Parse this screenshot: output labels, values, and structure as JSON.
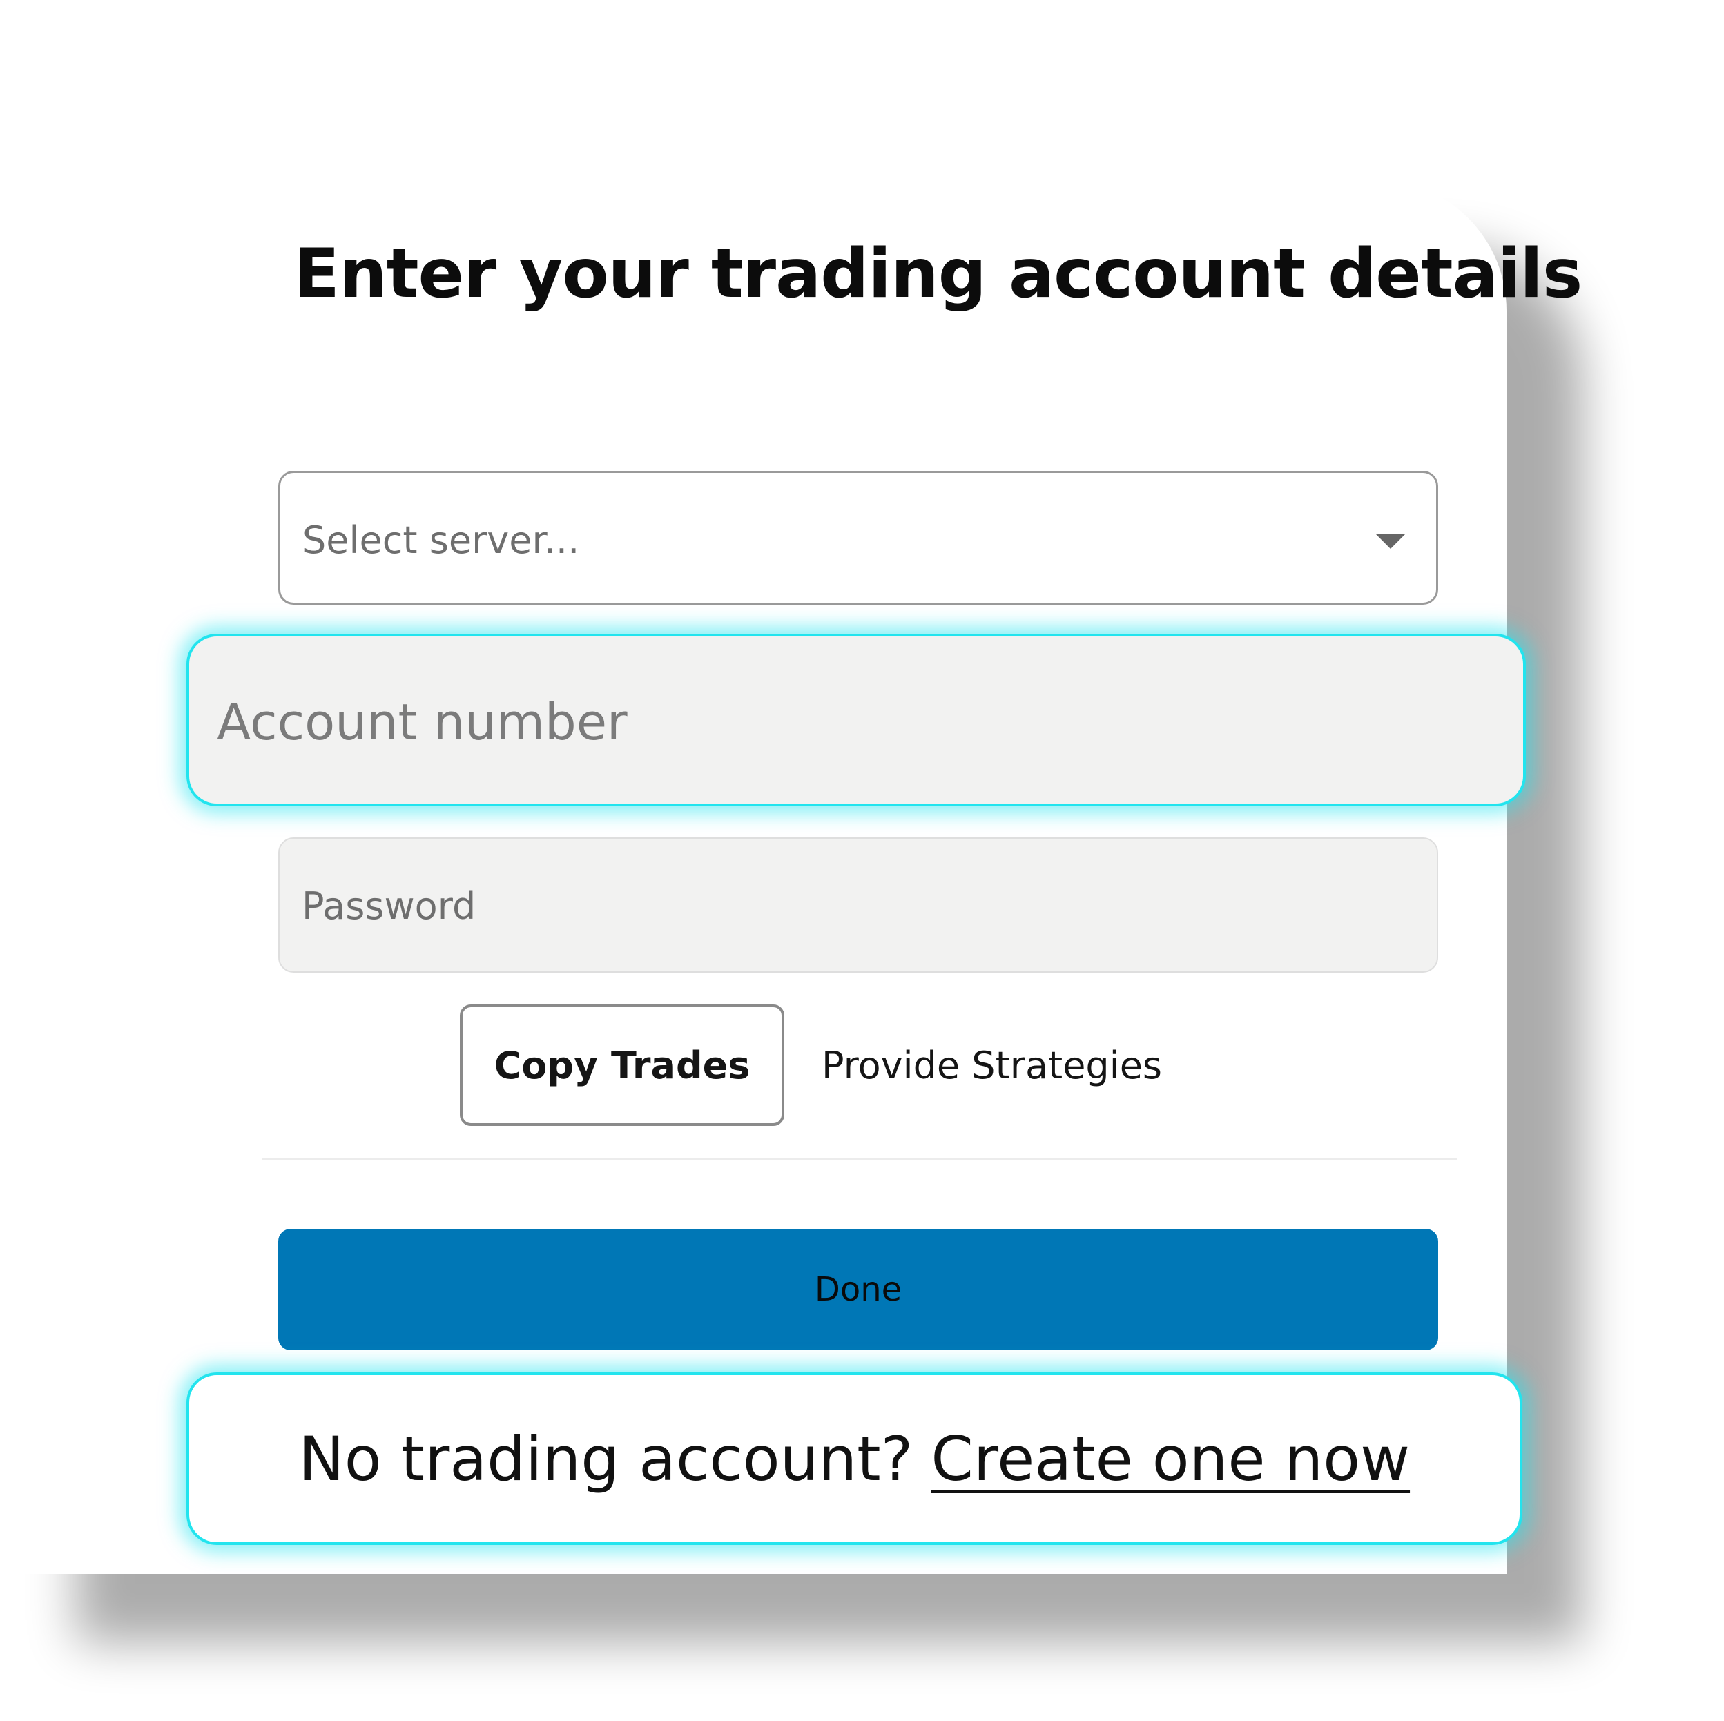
{
  "dialog": {
    "title": "Enter your trading account details"
  },
  "form": {
    "server_select": {
      "placeholder": "Select server...",
      "icon": "chevron-down-icon"
    },
    "account_number": {
      "placeholder": "Account number",
      "value": ""
    },
    "password": {
      "placeholder": "Password",
      "value": ""
    }
  },
  "mode_tabs": {
    "copy_trades": "Copy Trades",
    "provide_strategies": "Provide Strategies",
    "selected": "Copy Trades"
  },
  "actions": {
    "done_label": "Done"
  },
  "footer": {
    "prompt": "No trading account?",
    "link": "Create one now"
  },
  "colors": {
    "primary_button": "#0077b6",
    "highlight": "#22e4ee",
    "field_background": "#f2f2f1"
  }
}
